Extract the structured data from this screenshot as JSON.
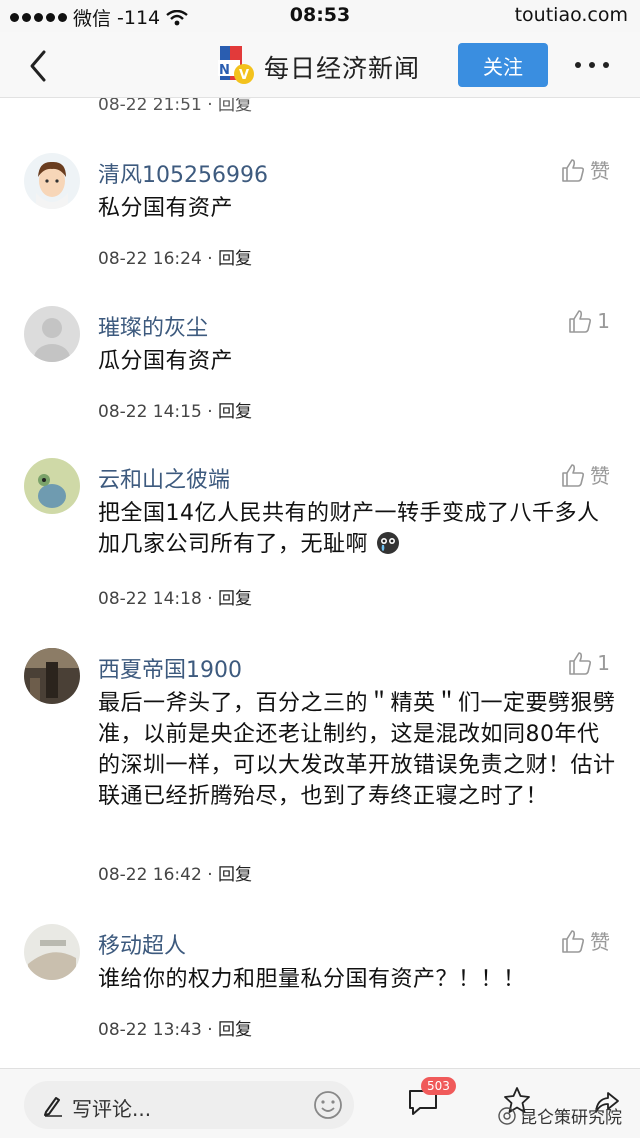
{
  "status_bar": {
    "carrier": "微信",
    "signal": "-114",
    "time": "08:53",
    "url": "toutiao.com"
  },
  "nav": {
    "title": "每日经济新闻",
    "follow_label": "关注"
  },
  "cut_meta": "08-22 21:51 · 回复",
  "comments": [
    {
      "username": "清风105256996",
      "like_label": "赞",
      "text": "私分国有资产",
      "time": "08-22 16:24",
      "reply": "回复"
    },
    {
      "username": "璀璨的灰尘",
      "like_label": "1",
      "text": "瓜分国有资产",
      "time": "08-22 14:15",
      "reply": "回复"
    },
    {
      "username": "云和山之彼端",
      "like_label": "赞",
      "text": "把全国14亿人民共有的财产一转手变成了八千多人加几家公司所有了，无耻啊",
      "time": "08-22 14:18",
      "reply": "回复"
    },
    {
      "username": "西夏帝国1900",
      "like_label": "1",
      "text": "最后一斧头了，百分之三的＂精英＂们一定要劈狠劈准，以前是央企还老让制约，这是混改如同80年代的深圳一样，可以大发改革开放错误免责之财！估计联通已经折腾殆尽，也到了寿终正寝之时了！",
      "time": "08-22 16:42",
      "reply": "回复"
    },
    {
      "username": "移动超人",
      "like_label": "赞",
      "text": "谁给你的权力和胆量私分国有资产？！！！",
      "time": "08-22 13:43",
      "reply": "回复"
    }
  ],
  "bottom_bar": {
    "placeholder": "写评论...",
    "comment_count": "503",
    "watermark": "昆仑策研究院"
  }
}
